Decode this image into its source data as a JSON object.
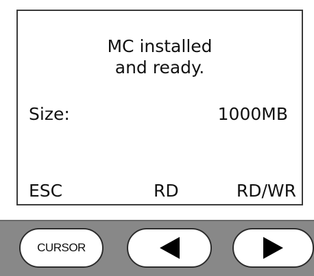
{
  "screen": {
    "message_line1": "MC installed",
    "message_line2": "and ready.",
    "size_label": "Size:",
    "size_value": "1000MB",
    "softkeys": {
      "esc": "ESC",
      "rd": "RD",
      "rdwr": "RD/WR"
    }
  },
  "panel": {
    "cursor_label": "CURSOR",
    "left_icon": "left-arrow-icon",
    "right_icon": "right-arrow-icon",
    "background_color": "#888888"
  }
}
